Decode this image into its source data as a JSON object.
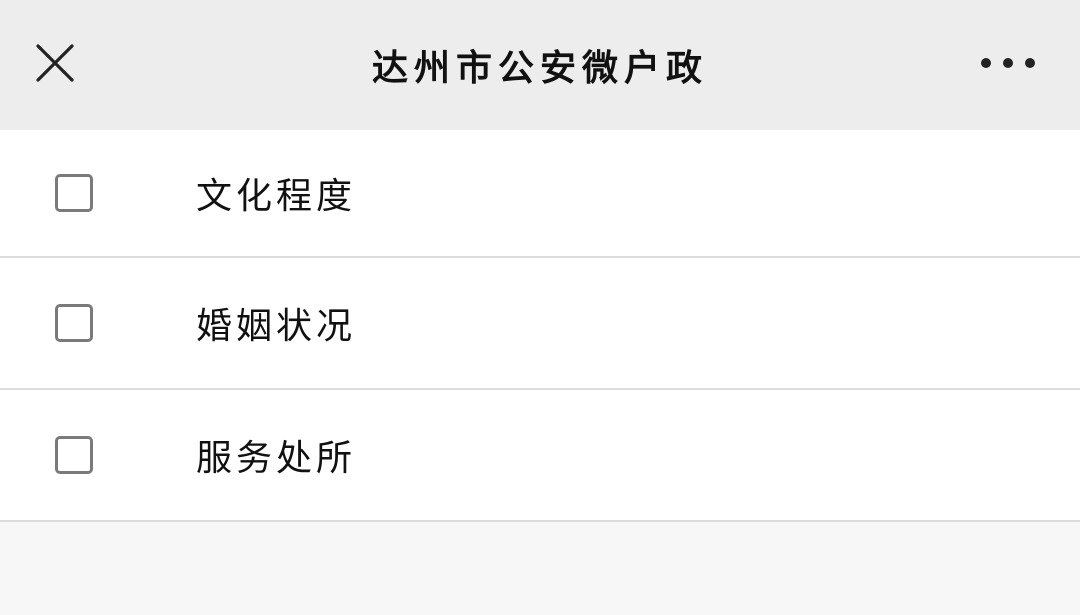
{
  "header": {
    "title": "达州市公安微户政",
    "close_icon": "close-icon",
    "more_icon": "more-icon"
  },
  "options": [
    {
      "label": "文化程度",
      "checked": false
    },
    {
      "label": "婚姻状况",
      "checked": false
    },
    {
      "label": "服务处所",
      "checked": false
    }
  ]
}
